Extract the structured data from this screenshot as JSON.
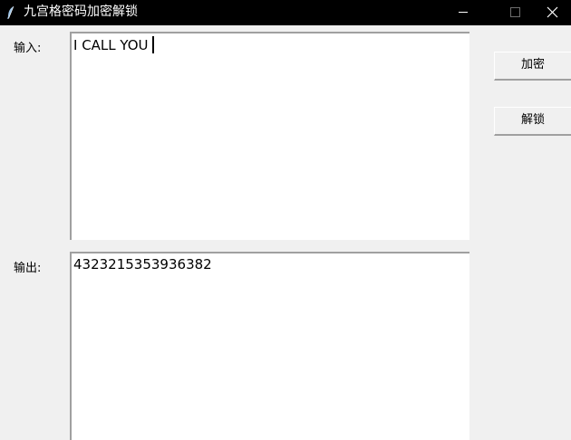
{
  "window": {
    "title": "九宫格密码加密解锁",
    "icons": {
      "app": "feather-icon",
      "minimize": "minimize-icon",
      "maximize": "maximize-icon",
      "close": "close-icon"
    }
  },
  "form": {
    "input_label": "输入:",
    "input_value": "I CALL YOU",
    "output_label": "输出:",
    "output_value": "4323215353936382"
  },
  "buttons": {
    "encrypt_label": "加密",
    "decrypt_label": "解锁"
  },
  "colors": {
    "titlebar": "#000000",
    "background": "#f0f0f0",
    "textbox": "#ffffff"
  }
}
